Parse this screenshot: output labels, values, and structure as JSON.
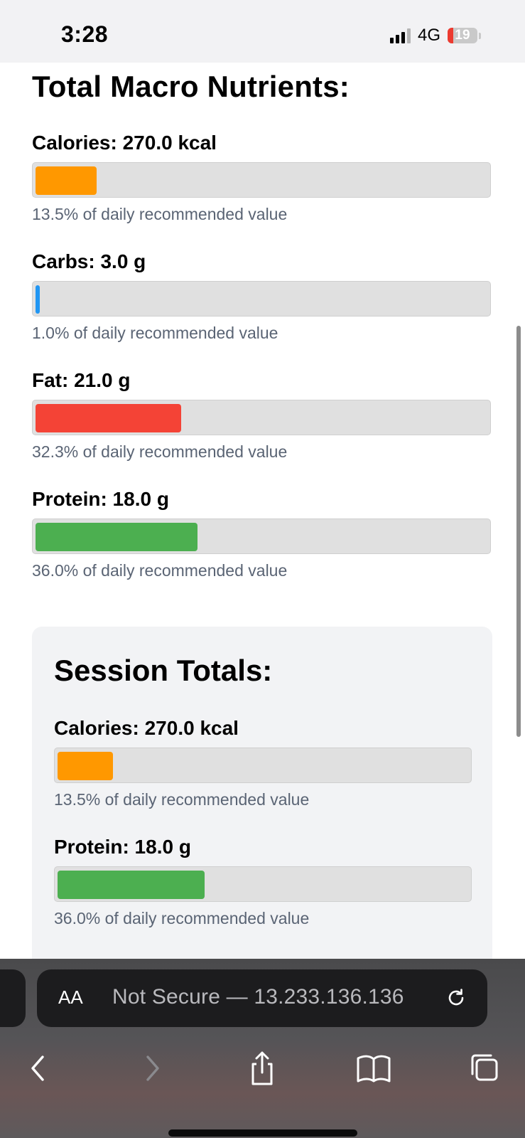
{
  "status_bar": {
    "time": "3:28",
    "network": "4G",
    "battery": "19"
  },
  "main": {
    "title": "Total Macro Nutrients:",
    "macros": [
      {
        "label": "Calories: 270.0 kcal",
        "percent": 13.5,
        "note": "13.5% of daily recommended value",
        "color": "#ff9800"
      },
      {
        "label": "Carbs: 3.0 g",
        "percent": 1.0,
        "note": "1.0% of daily recommended value",
        "color": "#2196f3"
      },
      {
        "label": "Fat: 21.0 g",
        "percent": 32.3,
        "note": "32.3% of daily recommended value",
        "color": "#f44336"
      },
      {
        "label": "Protein: 18.0 g",
        "percent": 36.0,
        "note": "36.0% of daily recommended value",
        "color": "#4caf50"
      }
    ]
  },
  "session": {
    "title": "Session Totals:",
    "macros": [
      {
        "label": "Calories: 270.0 kcal",
        "percent": 13.5,
        "note": "13.5% of daily recommended value",
        "color": "#ff9800"
      },
      {
        "label": "Protein: 18.0 g",
        "percent": 36.0,
        "note": "36.0% of daily recommended value",
        "color": "#4caf50"
      }
    ]
  },
  "browser": {
    "text_size_button": "AA",
    "address": "Not Secure — 13.233.136.136",
    "icons": {
      "reload": "reload-icon",
      "back": "back-chevron-icon",
      "forward": "forward-chevron-icon",
      "share": "share-icon",
      "bookmarks": "book-icon",
      "tabs": "tabs-icon"
    }
  }
}
